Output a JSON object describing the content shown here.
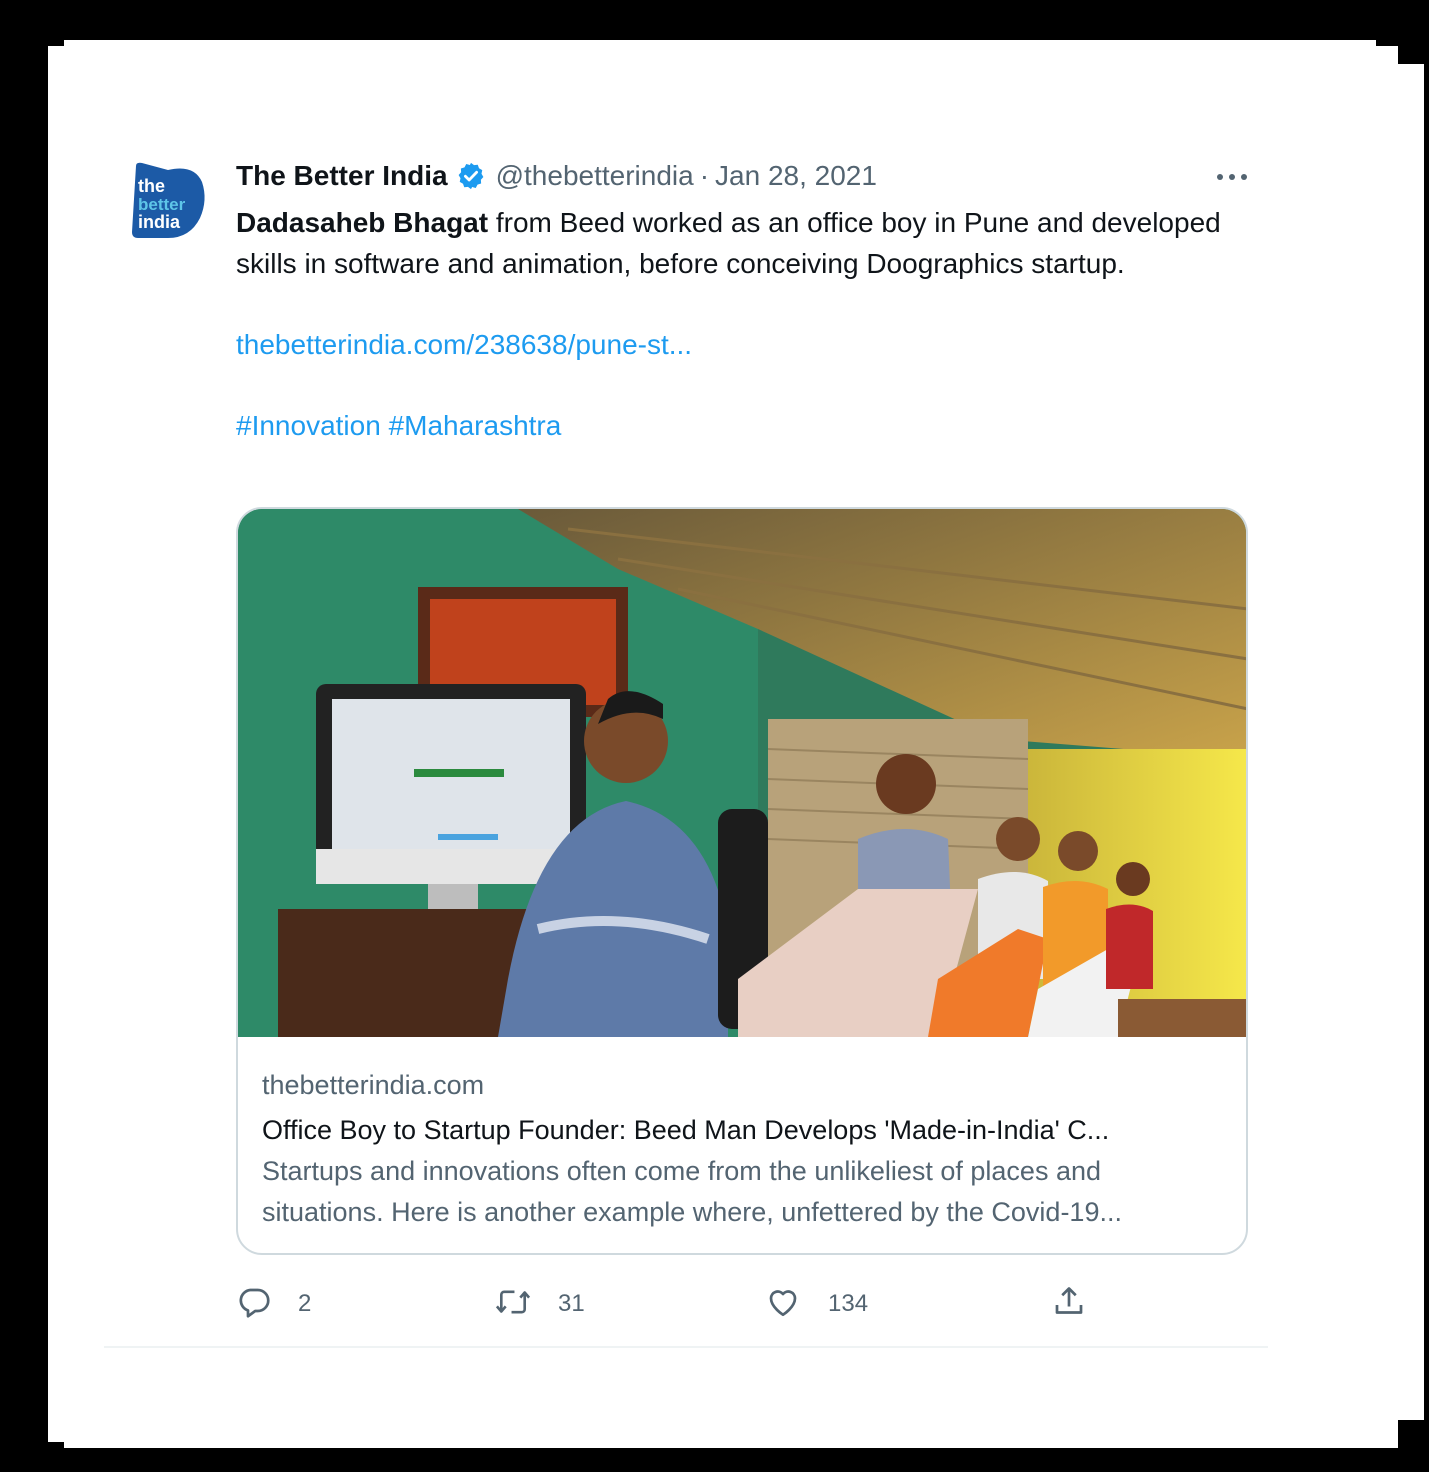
{
  "tweet": {
    "display_name": "The Better India",
    "handle": "@thebetterindia",
    "separator": "·",
    "date": "Jan 28, 2021",
    "avatar_text": [
      "the",
      "better",
      "india"
    ],
    "text_bold": "Dadasaheb Bhagat",
    "text_rest": " from Beed worked as an office boy in Pune and developed skills in software and animation, before conceiving Doographics startup.",
    "link": "thebetterindia.com/238638/pune-st...",
    "hashtags": "#Innovation #Maharashtra"
  },
  "card": {
    "domain": "thebetterindia.com",
    "title": "Office Boy to Startup Founder: Beed Man Develops 'Made-in-India' C...",
    "description": "Startups and innovations often come from the unlikeliest of places and situations. Here is another example where, unfettered by the Covid-19..."
  },
  "actions": {
    "replies": "2",
    "retweets": "31",
    "likes": "134"
  },
  "colors": {
    "accent": "#1d9bf0",
    "text": "#0f1419",
    "secondary": "#536471",
    "border": "#cfd9de",
    "avatar_blue": "#1c5aa6"
  }
}
